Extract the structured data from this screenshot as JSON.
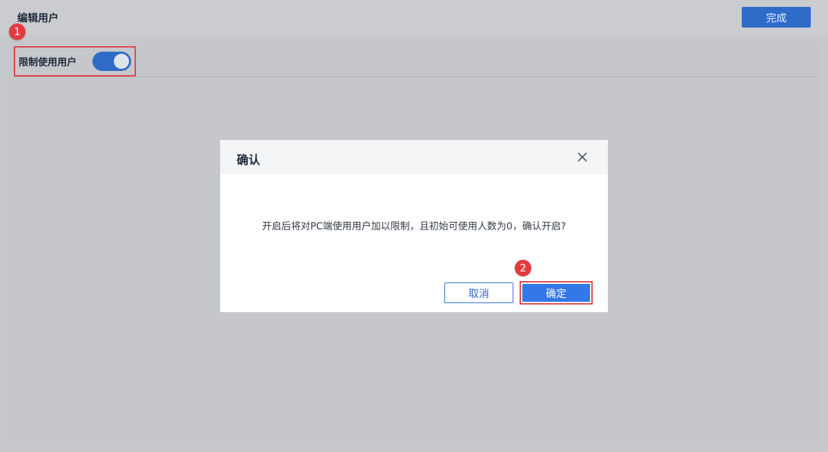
{
  "header": {
    "title": "编辑用户",
    "done_label": "完成"
  },
  "settings": {
    "restrict_label": "限制使用用户",
    "restrict_enabled": true
  },
  "steps": [
    "1",
    "2"
  ],
  "dialog": {
    "title": "确认",
    "message": "开启后将对PC端使用用户加以限制，且初始可使用人数为0，确认开启?",
    "cancel_label": "取消",
    "ok_label": "确定"
  },
  "colors": {
    "primary": "#2f6cc9",
    "annotation": "#e0444a"
  }
}
